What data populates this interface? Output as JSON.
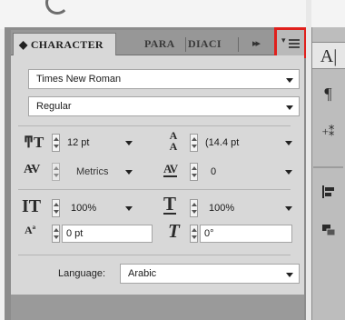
{
  "panel": {
    "tabs": {
      "character": "◆ CHARACTER",
      "paragraph": "PARA",
      "diacritics": "DIACI",
      "more": "▸▸"
    },
    "menu_icon": "panel-menu-icon",
    "font_family": "Times New Roman",
    "font_style": "Regular",
    "font_size": "12 pt",
    "leading": "(14.4 pt",
    "kerning": "Metrics",
    "tracking": "0",
    "vertical_scale": "100%",
    "horizontal_scale": "100%",
    "baseline_shift": "0 pt",
    "skew": "0°",
    "language_label": "Language:",
    "language": "Arabic"
  },
  "dock": {
    "buttons": [
      "A|",
      "¶",
      "+/-",
      "align",
      "layers"
    ]
  },
  "colors": {
    "highlight": "#e0201c",
    "panel_bg": "#d8d8d8",
    "tab_bar": "#979797"
  }
}
